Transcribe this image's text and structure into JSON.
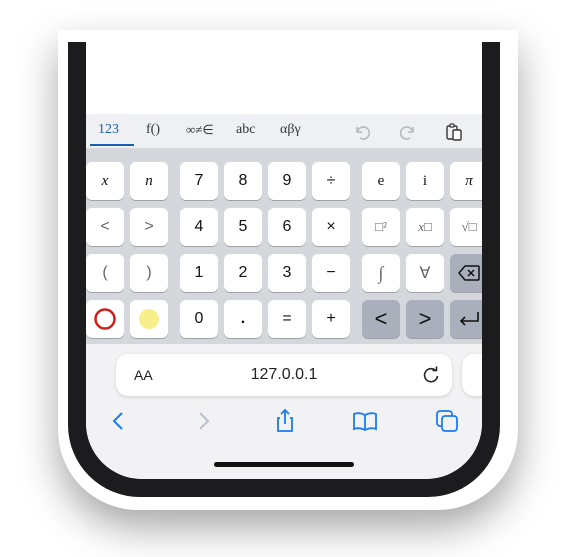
{
  "keyboard": {
    "tabs": [
      "123",
      "f()",
      "∞≠∈",
      "abc",
      "αβγ"
    ],
    "rows": [
      [
        "x",
        "n",
        "7",
        "8",
        "9",
        "÷",
        "e",
        "i",
        "π"
      ],
      [
        "<",
        ">",
        "4",
        "5",
        "6",
        "×",
        "□²",
        "x□",
        "√□"
      ],
      [
        "(",
        ")",
        "1",
        "2",
        "3",
        "−",
        "∫",
        "∀",
        ""
      ],
      [
        "",
        "",
        "0",
        ".",
        "=",
        "+",
        "<",
        ">",
        ""
      ]
    ]
  },
  "browser": {
    "text_size_label": "AA",
    "url": "127.0.0.1"
  },
  "colors": {
    "accent": "#1a5fb4",
    "red_circle": "#d0201a",
    "yellow_circle": "#f7f08a",
    "dark_key": "#a9b0bb",
    "keyboard_bg": "#d4d7dc"
  }
}
